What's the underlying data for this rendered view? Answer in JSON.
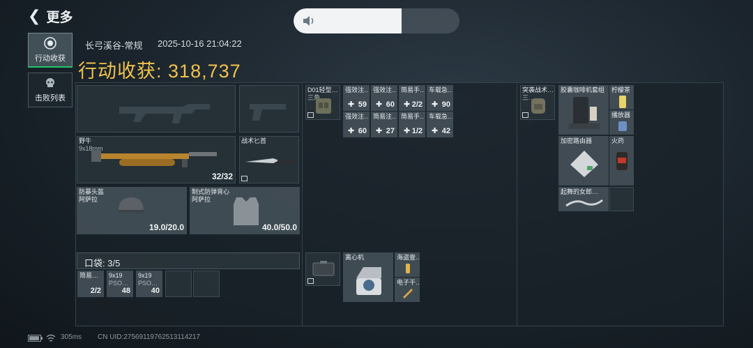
{
  "nav": {
    "back_label": "更多"
  },
  "volume": {
    "level": 0.65
  },
  "sidebar": {
    "tabs": [
      {
        "label": "行动收获",
        "icon": "loot-icon",
        "active": true
      },
      {
        "label": "击败列表",
        "icon": "skull-icon",
        "active": false
      }
    ]
  },
  "header": {
    "map": "长弓溪谷-常规",
    "time": "2025-10-16 21:04:22",
    "total_label": "行动收获:",
    "total_value": "318,737"
  },
  "equipment": {
    "primary": {
      "name": "野牛",
      "ammo": "9x18mm",
      "count": "32/32"
    },
    "melee": {
      "name": "战术匕首"
    },
    "helmet": {
      "name": "防暴头盔",
      "maker": "阿萨拉",
      "durability": "19.0/20.0"
    },
    "armor": {
      "name": "制式防弹背心",
      "maker": "阿萨拉",
      "durability": "40.0/50.0"
    }
  },
  "pocket": {
    "label": "口袋: 3/5",
    "items": [
      {
        "name": "简易…",
        "count": "2/2"
      },
      {
        "name": "9x19",
        "sub": "PSO…",
        "count": "48"
      },
      {
        "name": "9x19",
        "sub": "PSO…",
        "count": "40"
      }
    ]
  },
  "chest_rig": {
    "name": "D01轻型…",
    "sub": "三角…",
    "items": [
      {
        "name": "强效注…",
        "count": "59"
      },
      {
        "name": "强效注…",
        "count": "60"
      },
      {
        "name": "简易手…",
        "count": "2/2"
      },
      {
        "name": "车载急…",
        "count": "90"
      },
      {
        "name": "强效注…",
        "count": "60"
      },
      {
        "name": "简易注…",
        "count": "27"
      },
      {
        "name": "简易手…",
        "count": "1/2"
      },
      {
        "name": "车载急…",
        "count": "42"
      }
    ]
  },
  "case": {
    "items": [
      {
        "name": "离心机"
      },
      {
        "name": "海盗壹…"
      },
      {
        "name": "电子干…"
      }
    ]
  },
  "backpack": {
    "name": "突袭战术…",
    "sub": "三…",
    "items": [
      {
        "name": "胶囊咖啡机套组"
      },
      {
        "name": "柠檬茶"
      },
      {
        "name": "播放器"
      },
      {
        "name": "加密路由器"
      },
      {
        "name": "火药"
      },
      {
        "name": "起舞的女郎…"
      }
    ]
  },
  "footer": {
    "ping": "305ms",
    "uid": "CN UID:2756911976251311421​7"
  }
}
